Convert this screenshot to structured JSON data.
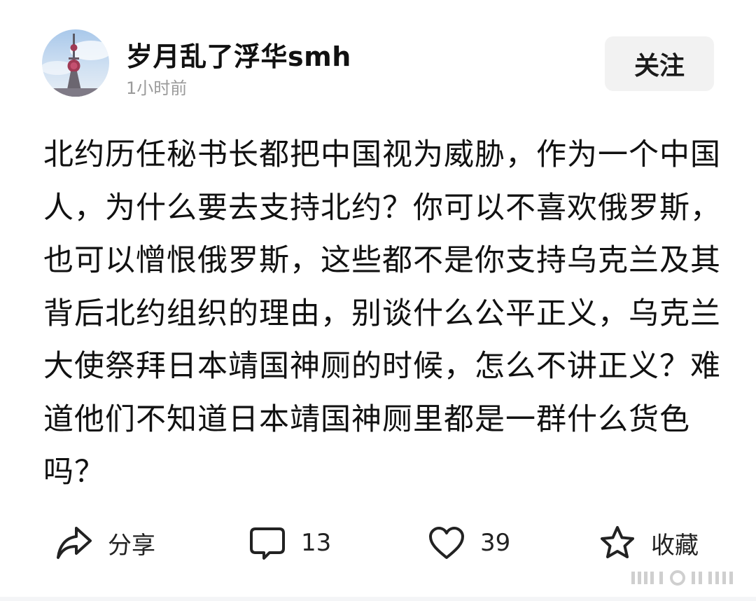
{
  "author": {
    "name": "岁月乱了浮华smh",
    "time": "1小时前"
  },
  "follow_label": "关注",
  "post": {
    "text": "北约历任秘书长都把中国视为威胁，作为一个中国人，为什么要去支持北约？你可以不喜欢俄罗斯，也可以憎恨俄罗斯，这些都不是你支持乌克兰及其背后北约组织的理由，别谈什么公平正义，乌克兰大使祭拜日本靖国神厕的时候，怎么不讲正义？难道他们不知道日本靖国神厕里都是一群什么货色吗？"
  },
  "actions": {
    "share": {
      "label": "分享",
      "icon": "share-icon"
    },
    "comment": {
      "label": "13",
      "icon": "comment-icon"
    },
    "like": {
      "label": "39",
      "icon": "heart-icon"
    },
    "favorite": {
      "label": "收藏",
      "icon": "star-icon"
    }
  },
  "colors": {
    "text": "#111111",
    "muted": "#9a9a9a",
    "button_bg": "#f2f2f2"
  }
}
